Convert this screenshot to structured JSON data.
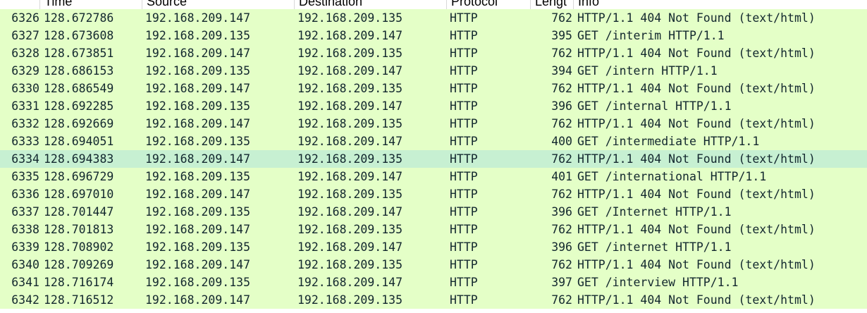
{
  "columns": {
    "no": "",
    "time": "Time",
    "source": "Source",
    "destination": "Destination",
    "protocol": "Protocol",
    "length": "Lengt",
    "info": "Info"
  },
  "selected_row": 8,
  "colors": {
    "row_bg": "#e4ffc7",
    "selected_bg": "#c7f0d2",
    "text": "#12272e"
  },
  "rows": [
    {
      "no": "6326",
      "time": "128.672786",
      "source": "192.168.209.147",
      "destination": "192.168.209.135",
      "protocol": "HTTP",
      "length": "762",
      "info": "HTTP/1.1 404 Not Found  (text/html)"
    },
    {
      "no": "6327",
      "time": "128.673608",
      "source": "192.168.209.135",
      "destination": "192.168.209.147",
      "protocol": "HTTP",
      "length": "395",
      "info": "GET /interim HTTP/1.1"
    },
    {
      "no": "6328",
      "time": "128.673851",
      "source": "192.168.209.147",
      "destination": "192.168.209.135",
      "protocol": "HTTP",
      "length": "762",
      "info": "HTTP/1.1 404 Not Found  (text/html)"
    },
    {
      "no": "6329",
      "time": "128.686153",
      "source": "192.168.209.135",
      "destination": "192.168.209.147",
      "protocol": "HTTP",
      "length": "394",
      "info": "GET /intern HTTP/1.1"
    },
    {
      "no": "6330",
      "time": "128.686549",
      "source": "192.168.209.147",
      "destination": "192.168.209.135",
      "protocol": "HTTP",
      "length": "762",
      "info": "HTTP/1.1 404 Not Found  (text/html)"
    },
    {
      "no": "6331",
      "time": "128.692285",
      "source": "192.168.209.135",
      "destination": "192.168.209.147",
      "protocol": "HTTP",
      "length": "396",
      "info": "GET /internal HTTP/1.1"
    },
    {
      "no": "6332",
      "time": "128.692669",
      "source": "192.168.209.147",
      "destination": "192.168.209.135",
      "protocol": "HTTP",
      "length": "762",
      "info": "HTTP/1.1 404 Not Found  (text/html)"
    },
    {
      "no": "6333",
      "time": "128.694051",
      "source": "192.168.209.135",
      "destination": "192.168.209.147",
      "protocol": "HTTP",
      "length": "400",
      "info": "GET /intermediate HTTP/1.1"
    },
    {
      "no": "6334",
      "time": "128.694383",
      "source": "192.168.209.147",
      "destination": "192.168.209.135",
      "protocol": "HTTP",
      "length": "762",
      "info": "HTTP/1.1 404 Not Found  (text/html)"
    },
    {
      "no": "6335",
      "time": "128.696729",
      "source": "192.168.209.135",
      "destination": "192.168.209.147",
      "protocol": "HTTP",
      "length": "401",
      "info": "GET /international HTTP/1.1"
    },
    {
      "no": "6336",
      "time": "128.697010",
      "source": "192.168.209.147",
      "destination": "192.168.209.135",
      "protocol": "HTTP",
      "length": "762",
      "info": "HTTP/1.1 404 Not Found  (text/html)"
    },
    {
      "no": "6337",
      "time": "128.701447",
      "source": "192.168.209.135",
      "destination": "192.168.209.147",
      "protocol": "HTTP",
      "length": "396",
      "info": "GET /Internet HTTP/1.1"
    },
    {
      "no": "6338",
      "time": "128.701813",
      "source": "192.168.209.147",
      "destination": "192.168.209.135",
      "protocol": "HTTP",
      "length": "762",
      "info": "HTTP/1.1 404 Not Found  (text/html)"
    },
    {
      "no": "6339",
      "time": "128.708902",
      "source": "192.168.209.135",
      "destination": "192.168.209.147",
      "protocol": "HTTP",
      "length": "396",
      "info": "GET /internet HTTP/1.1"
    },
    {
      "no": "6340",
      "time": "128.709269",
      "source": "192.168.209.147",
      "destination": "192.168.209.135",
      "protocol": "HTTP",
      "length": "762",
      "info": "HTTP/1.1 404 Not Found  (text/html)"
    },
    {
      "no": "6341",
      "time": "128.716174",
      "source": "192.168.209.135",
      "destination": "192.168.209.147",
      "protocol": "HTTP",
      "length": "397",
      "info": "GET /interview HTTP/1.1"
    },
    {
      "no": "6342",
      "time": "128.716512",
      "source": "192.168.209.147",
      "destination": "192.168.209.135",
      "protocol": "HTTP",
      "length": "762",
      "info": "HTTP/1.1 404 Not Found  (text/html)"
    }
  ]
}
